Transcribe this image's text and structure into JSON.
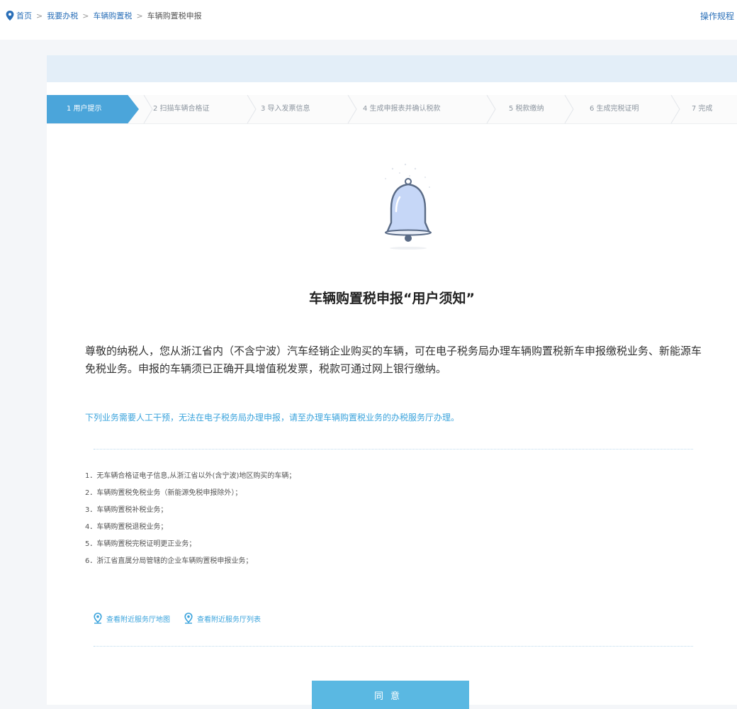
{
  "breadcrumb": {
    "items": [
      "首页",
      "我要办税",
      "车辆购置税",
      "车辆购置税申报"
    ],
    "separator": ">"
  },
  "header": {
    "help_link": "操作规程"
  },
  "steps": [
    {
      "label": "1 用户提示",
      "active": true
    },
    {
      "label": "2 扫描车辆合格证",
      "active": false
    },
    {
      "label": "3 导入发票信息",
      "active": false
    },
    {
      "label": "4 生成申报表并确认税款",
      "active": false
    },
    {
      "label": "5 税款缴纳",
      "active": false
    },
    {
      "label": "6 生成完税证明",
      "active": false
    },
    {
      "label": "7 完成",
      "active": false
    }
  ],
  "notice": {
    "title": "车辆购置税申报“用户须知”",
    "intro": "尊敬的纳税人，您从浙江省内（不含宁波）汽车经销企业购买的车辆，可在电子税务局办理车辆购置税新车申报缴税业务、新能源车免税业务。申报的车辆须已正确开具增值税发票，税款可通过网上银行缴纳。",
    "warning": "下列业务需要人工干预，无法在电子税务局办理申报，请至办理车辆购置税业务的办税服务厅办理。",
    "items": [
      "1．无车辆合格证电子信息,从浙江省以外(含宁波)地区购买的车辆；",
      "2．车辆购置税免税业务（新能源免税申报除外）；",
      "3．车辆购置税补税业务；",
      "4．车辆购置税退税业务；",
      "5．车辆购置税完税证明更正业务；",
      "6．浙江省直属分局管辖的企业车辆购置税申报业务；"
    ]
  },
  "links": {
    "map": "查看附近服务厅地图",
    "list": "查看附近服务厅列表"
  },
  "buttons": {
    "agree": "同意"
  },
  "colors": {
    "accent": "#4ba5da",
    "link": "#2a6fb8",
    "warning_text": "#3aa3dc"
  }
}
